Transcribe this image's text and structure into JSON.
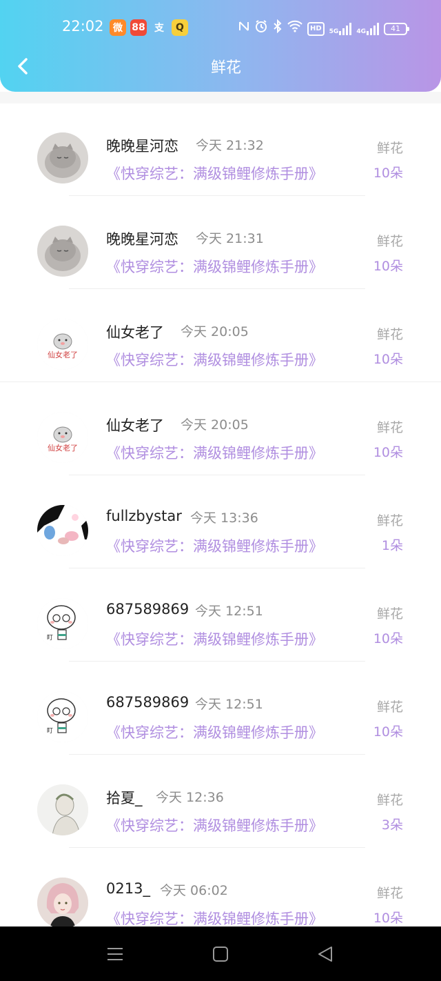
{
  "status_bar": {
    "time": "22:02",
    "notifications": [
      {
        "icon": "weibo-icon",
        "glyph": "微",
        "color": "#ff8a2a"
      },
      {
        "icon": "app-icon",
        "glyph": "88",
        "color": "#f04a37"
      },
      {
        "icon": "alipay-icon",
        "glyph": "支",
        "color": "transparent"
      },
      {
        "icon": "qq-icon",
        "glyph": "Q",
        "color": "#f7cf3c"
      }
    ],
    "hd_label": "HD",
    "net_5g": "5G",
    "net_4g": "4G",
    "battery": "41"
  },
  "header": {
    "title": "鲜花",
    "back_icon": "chevron-left-icon"
  },
  "records": [
    {
      "user": "晚晚星河恋",
      "time": "今天 21:32",
      "book": "《快穿综艺：满级锦鲤修炼手册》",
      "gift": "鲜花",
      "count": "10朵",
      "avatar": "cat"
    },
    {
      "user": "晚晚星河恋",
      "time": "今天 21:31",
      "book": "《快穿综艺：满级锦鲤修炼手册》",
      "gift": "鲜花",
      "count": "10朵",
      "avatar": "cat"
    },
    {
      "user": "仙女老了",
      "time": "今天 20:05",
      "book": "《快穿综艺：满级锦鲤修炼手册》",
      "gift": "鲜花",
      "count": "10朵",
      "avatar": "hamster"
    },
    {
      "user": "仙女老了",
      "time": "今天 20:05",
      "book": "《快穿综艺：满级锦鲤修炼手册》",
      "gift": "鲜花",
      "count": "10朵",
      "avatar": "hamster"
    },
    {
      "user": "fullzbystar",
      "time": "今天 13:36",
      "book": "《快穿综艺：满级锦鲤修炼手册》",
      "gift": "鲜花",
      "count": "1朵",
      "avatar": "cow"
    },
    {
      "user": "687589869",
      "time": "今天 12:51",
      "book": "《快穿综艺：满级锦鲤修炼手册》",
      "gift": "鲜花",
      "count": "10朵",
      "avatar": "bear"
    },
    {
      "user": "687589869",
      "time": "今天 12:51",
      "book": "《快穿综艺：满级锦鲤修炼手册》",
      "gift": "鲜花",
      "count": "10朵",
      "avatar": "bear"
    },
    {
      "user": "拾夏_",
      "time": "今天 12:36",
      "book": "《快穿综艺：满级锦鲤修炼手册》",
      "gift": "鲜花",
      "count": "3朵",
      "avatar": "sketch"
    },
    {
      "user": "0213_",
      "time": "今天 06:02",
      "book": "《快穿综艺：满级锦鲤修炼手册》",
      "gift": "鲜花",
      "count": "10朵",
      "avatar": "girl"
    }
  ],
  "nav_bar": {
    "buttons": [
      {
        "icon": "menu-icon"
      },
      {
        "icon": "home-icon"
      },
      {
        "icon": "back-triangle-icon"
      }
    ]
  }
}
